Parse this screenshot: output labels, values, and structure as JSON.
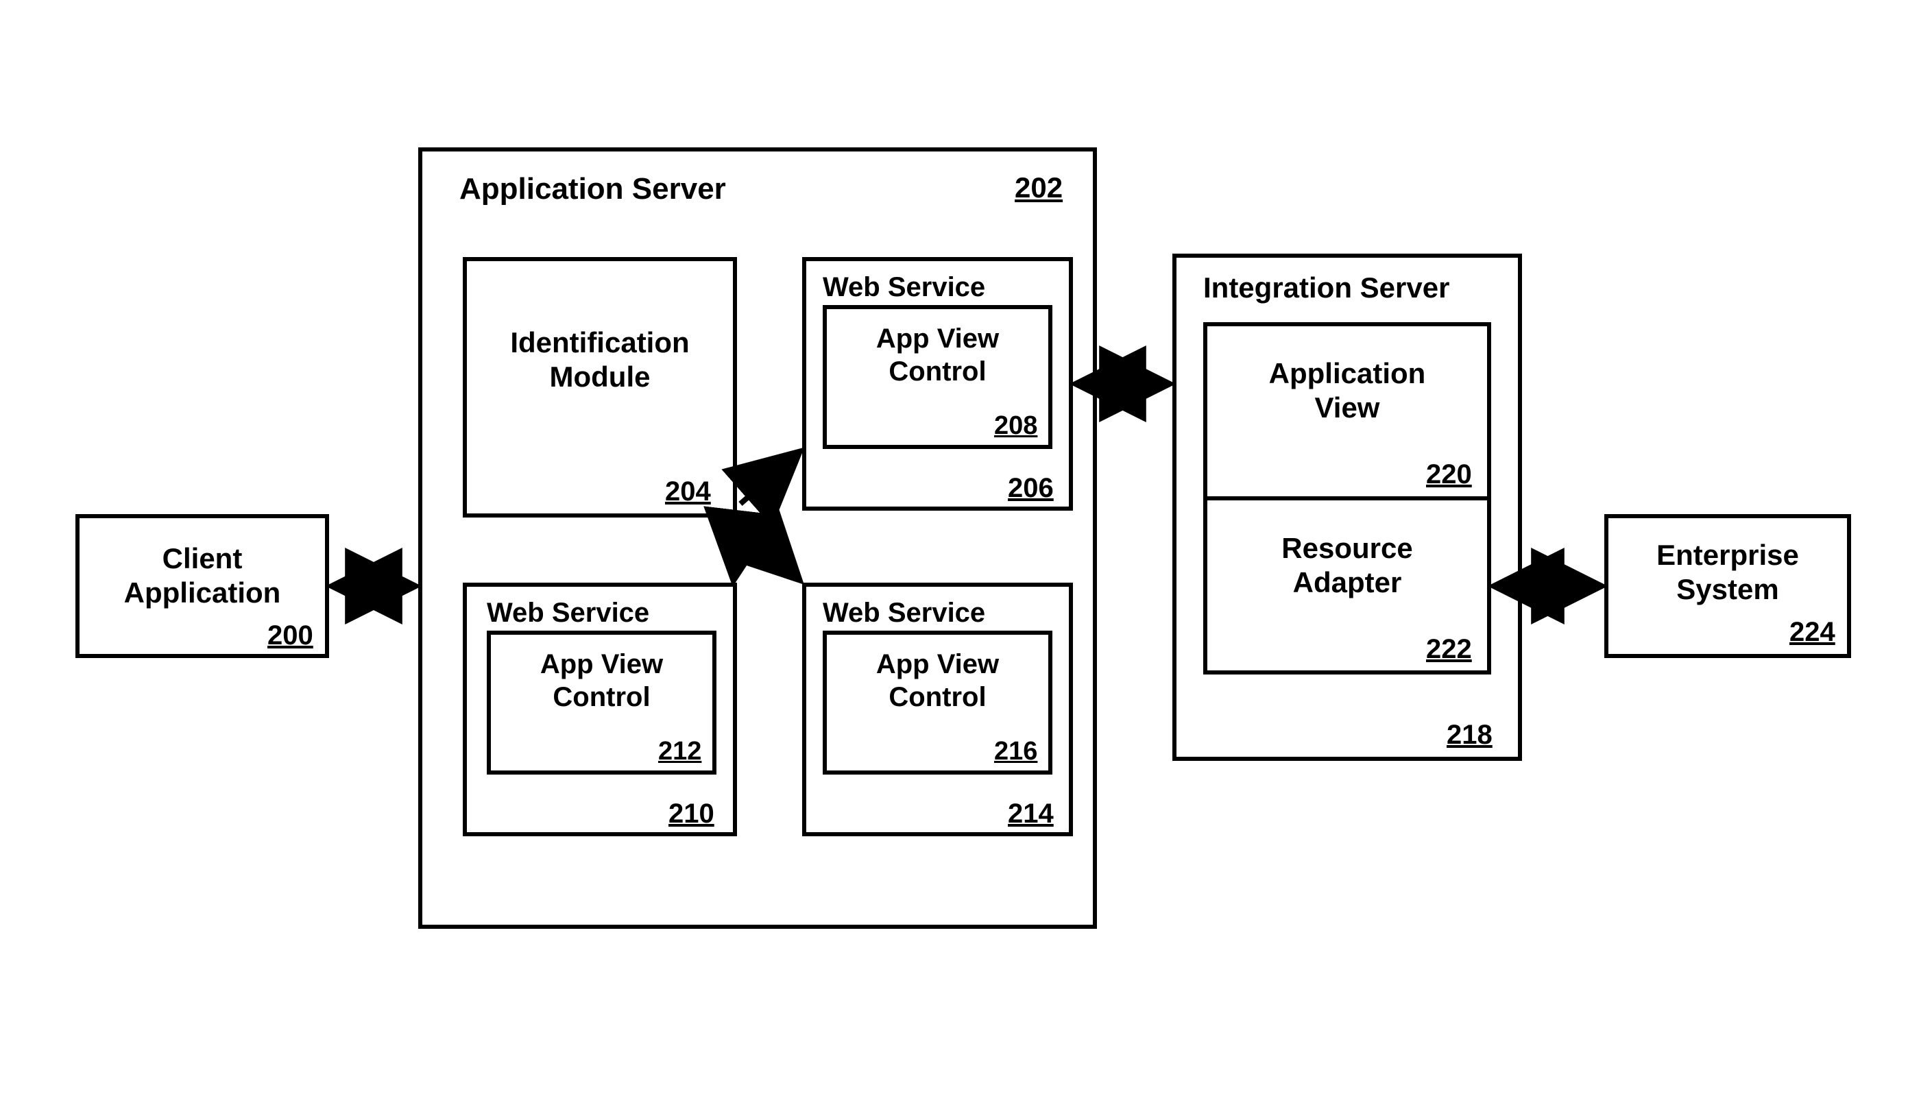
{
  "client": {
    "title": "Client\nApplication",
    "ref": "200"
  },
  "appServer": {
    "title": "Application Server",
    "ref": "202",
    "idModule": {
      "title": "Identification\nModule",
      "ref": "204"
    },
    "ws206": {
      "title": "Web Service",
      "ref": "206",
      "avc": {
        "title": "App View\nControl",
        "ref": "208"
      }
    },
    "ws210": {
      "title": "Web Service",
      "ref": "210",
      "avc": {
        "title": "App View\nControl",
        "ref": "212"
      }
    },
    "ws214": {
      "title": "Web Service",
      "ref": "214",
      "avc": {
        "title": "App View\nControl",
        "ref": "216"
      }
    }
  },
  "intServer": {
    "title": "Integration Server",
    "ref": "218",
    "appView": {
      "title": "Application\nView",
      "ref": "220"
    },
    "resAdapter": {
      "title": "Resource\nAdapter",
      "ref": "222"
    }
  },
  "enterprise": {
    "title": "Enterprise\nSystem",
    "ref": "224"
  }
}
